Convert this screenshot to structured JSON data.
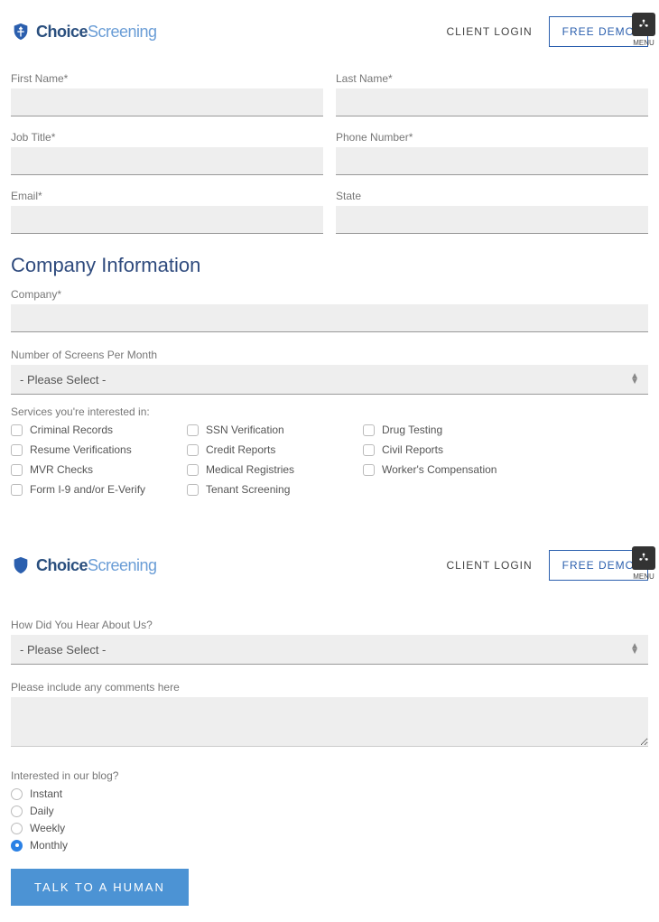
{
  "header": {
    "brand1": "Choice",
    "brand2": "Screening",
    "client_login": "CLIENT LOGIN",
    "free_demo": "FREE DEMO",
    "menu": "MENU"
  },
  "contact": {
    "first_name_label": "First Name*",
    "last_name_label": "Last Name*",
    "job_title_label": "Job Title*",
    "phone_label": "Phone Number*",
    "email_label": "Email*",
    "state_label": "State"
  },
  "company": {
    "title": "Company Information",
    "company_label": "Company*",
    "screens_label": "Number of Screens Per Month",
    "screens_placeholder": "- Please Select -",
    "services_label": "Services you're interested in:",
    "services": {
      "criminal": "Criminal Records",
      "resume": "Resume Verifications",
      "mvr": "MVR Checks",
      "i9": "Form I-9 and/or E-Verify",
      "ssn": "SSN Verification",
      "credit": "Credit Reports",
      "medical": "Medical Registries",
      "tenant": "Tenant Screening",
      "drug": "Drug Testing",
      "civil": "Civil Reports",
      "workers": "Worker's Compensation"
    }
  },
  "additional": {
    "hear_label": "How Did You Hear About Us?",
    "hear_placeholder": "- Please Select -",
    "comments_label": "Please include any comments here",
    "blog_label": "Interested in our blog?",
    "blog": {
      "instant": "Instant",
      "daily": "Daily",
      "weekly": "Weekly",
      "monthly": "Monthly"
    },
    "submit": "TALK TO A HUMAN"
  }
}
